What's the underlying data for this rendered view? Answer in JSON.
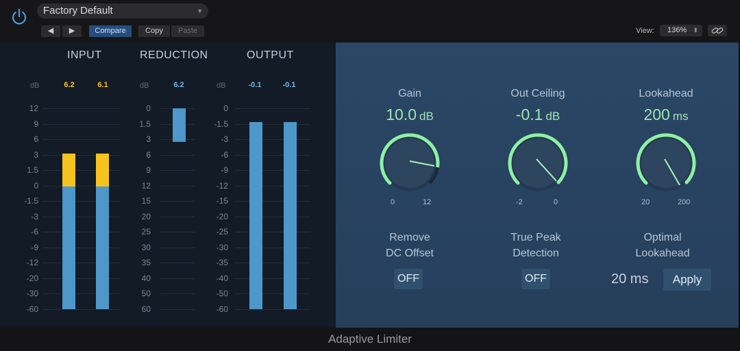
{
  "header": {
    "preset": "Factory Default",
    "compare_label": "Compare",
    "copy_label": "Copy",
    "paste_label": "Paste",
    "view_label": "View:",
    "zoom": "136%",
    "icons": {
      "power": "power-icon",
      "prev": "prev-arrow-icon",
      "next": "next-arrow-icon",
      "link": "link-icon"
    }
  },
  "meters": {
    "input": {
      "title": "INPUT",
      "unit": "dB",
      "peaks": [
        "6.2",
        "6.1"
      ],
      "scale": [
        "12",
        "9",
        "6",
        "3",
        "1.5",
        "0",
        "-1.5",
        "-3",
        "-6",
        "-9",
        "-12",
        "-20",
        "-30",
        "-60"
      ]
    },
    "reduction": {
      "title": "REDUCTION",
      "unit": "dB",
      "peak": "6.2",
      "scale": [
        "0",
        "1.5",
        "3",
        "6",
        "9",
        "12",
        "15",
        "20",
        "25",
        "30",
        "35",
        "40",
        "50",
        "60"
      ]
    },
    "output": {
      "title": "OUTPUT",
      "unit": "dB",
      "peaks": [
        "-0.1",
        "-0.1"
      ],
      "scale": [
        "0",
        "-1.5",
        "-3",
        "-6",
        "-9",
        "-12",
        "-15",
        "-20",
        "-25",
        "-30",
        "-35",
        "-40",
        "-50",
        "-60"
      ]
    },
    "colors": {
      "meter_blue": "#4d97c9",
      "over_yellow": "#f6c21d"
    }
  },
  "controls": {
    "gain": {
      "label": "Gain",
      "value": "10.0",
      "unit": "dB",
      "min": "0",
      "max": "12"
    },
    "ceiling": {
      "label": "Out Ceiling",
      "value": "-0.1",
      "unit": "dB",
      "min": "-2",
      "max": "0"
    },
    "lookahead": {
      "label": "Lookahead",
      "value": "200",
      "unit": "ms",
      "min": "20",
      "max": "200"
    },
    "dc_offset": {
      "label_line1": "Remove",
      "label_line2": "DC Offset",
      "state": "OFF"
    },
    "true_peak": {
      "label_line1": "True Peak",
      "label_line2": "Detection",
      "state": "OFF"
    },
    "optimal": {
      "label_line1": "Optimal",
      "label_line2": "Lookahead",
      "value": "20 ms",
      "apply_label": "Apply"
    },
    "colors": {
      "knob_ring": "#8ff0a4",
      "value_green": "#9fe3b1"
    }
  },
  "footer": {
    "title": "Adaptive Limiter"
  }
}
